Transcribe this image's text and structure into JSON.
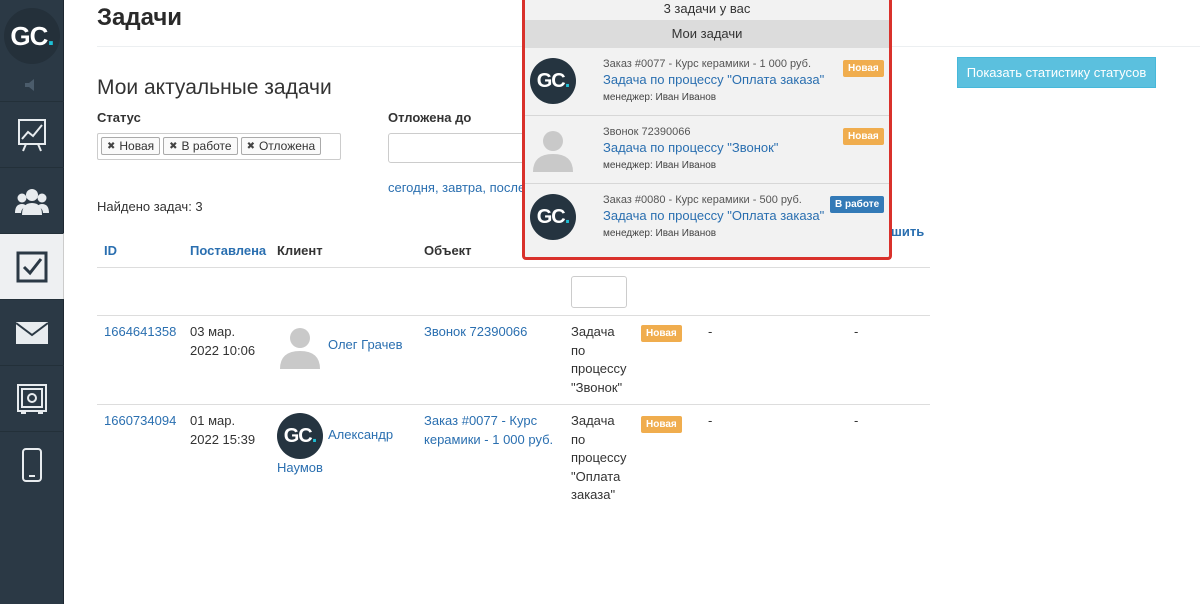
{
  "app": {
    "logo_text": "GC",
    "logo_dot": "."
  },
  "sidebar": {
    "items": [
      {
        "name": "chart-icon"
      },
      {
        "name": "users-icon"
      },
      {
        "name": "checkbox-icon",
        "active": true
      },
      {
        "name": "mail-icon"
      },
      {
        "name": "safe-icon"
      },
      {
        "name": "phone-icon"
      }
    ]
  },
  "header": {
    "title": "Задачи"
  },
  "main": {
    "section_title": "Мои актуальные задачи",
    "filters": {
      "status_label": "Статус",
      "status_chips": [
        "Новая",
        "В работе",
        "Отложена"
      ],
      "postponed_label": "Отложена до",
      "quick_today": "сегодня",
      "quick_sep": ", ",
      "quick_tomorrow": "завтра",
      "quick_after": "после"
    },
    "found": "Найдено задач: 3",
    "stat_button": "Показать статистику статусов",
    "table": {
      "headers": {
        "id": "ID",
        "posted": "Поставлена",
        "client": "Клиент",
        "object": "Объект",
        "hidden_tail": "шить"
      },
      "rows": [
        {
          "id": "1664641358",
          "date_line1": "03 мар.",
          "date_line2": "2022 10:06",
          "client": "Олег Грачев",
          "object": "Звонок 72390066",
          "task_lines": [
            "Задача",
            "по",
            "процессу",
            "\"Звонок\""
          ],
          "status": "Новая",
          "dash1": "-",
          "dash2": "-"
        },
        {
          "id": "1660734094",
          "date_line1": "01 мар.",
          "date_line2": "2022 15:39",
          "client_line1": "Александр",
          "client_line2": "Наумов",
          "object_line1": "Заказ #0077 - Курс",
          "object_line2": "керамики - 1 000 руб.",
          "task_lines": [
            "Задача",
            "по",
            "процессу",
            "\"Оплата",
            "заказа\""
          ],
          "status": "Новая",
          "dash1": "-",
          "dash2": "-"
        }
      ]
    }
  },
  "popup": {
    "header": "3 задачи у вас",
    "subheader": "Мои задачи",
    "items": [
      {
        "meta": "Заказ #0077 - Курс керамики - 1 000 руб.",
        "title": "Задача по процессу \"Оплата заказа\"",
        "manager": "менеджер: Иван Иванов",
        "status": "Новая",
        "avatar": "gc"
      },
      {
        "meta": "Звонок 72390066",
        "title": "Задача по процессу \"Звонок\"",
        "manager": "менеджер: Иван Иванов",
        "status": "Новая",
        "avatar": "person"
      },
      {
        "meta": "Заказ #0080 - Курс керамики - 500 руб.",
        "title": "Задача по процессу \"Оплата заказа\"",
        "manager": "менеджер: Иван Иванов",
        "status": "В работе",
        "avatar": "gc"
      }
    ]
  },
  "colors": {
    "accent": "#2a6fb0",
    "new_badge": "#f0ad4e",
    "work_badge": "#337ab7",
    "info_button": "#5bc0de",
    "sidebar": "#2b3945"
  }
}
